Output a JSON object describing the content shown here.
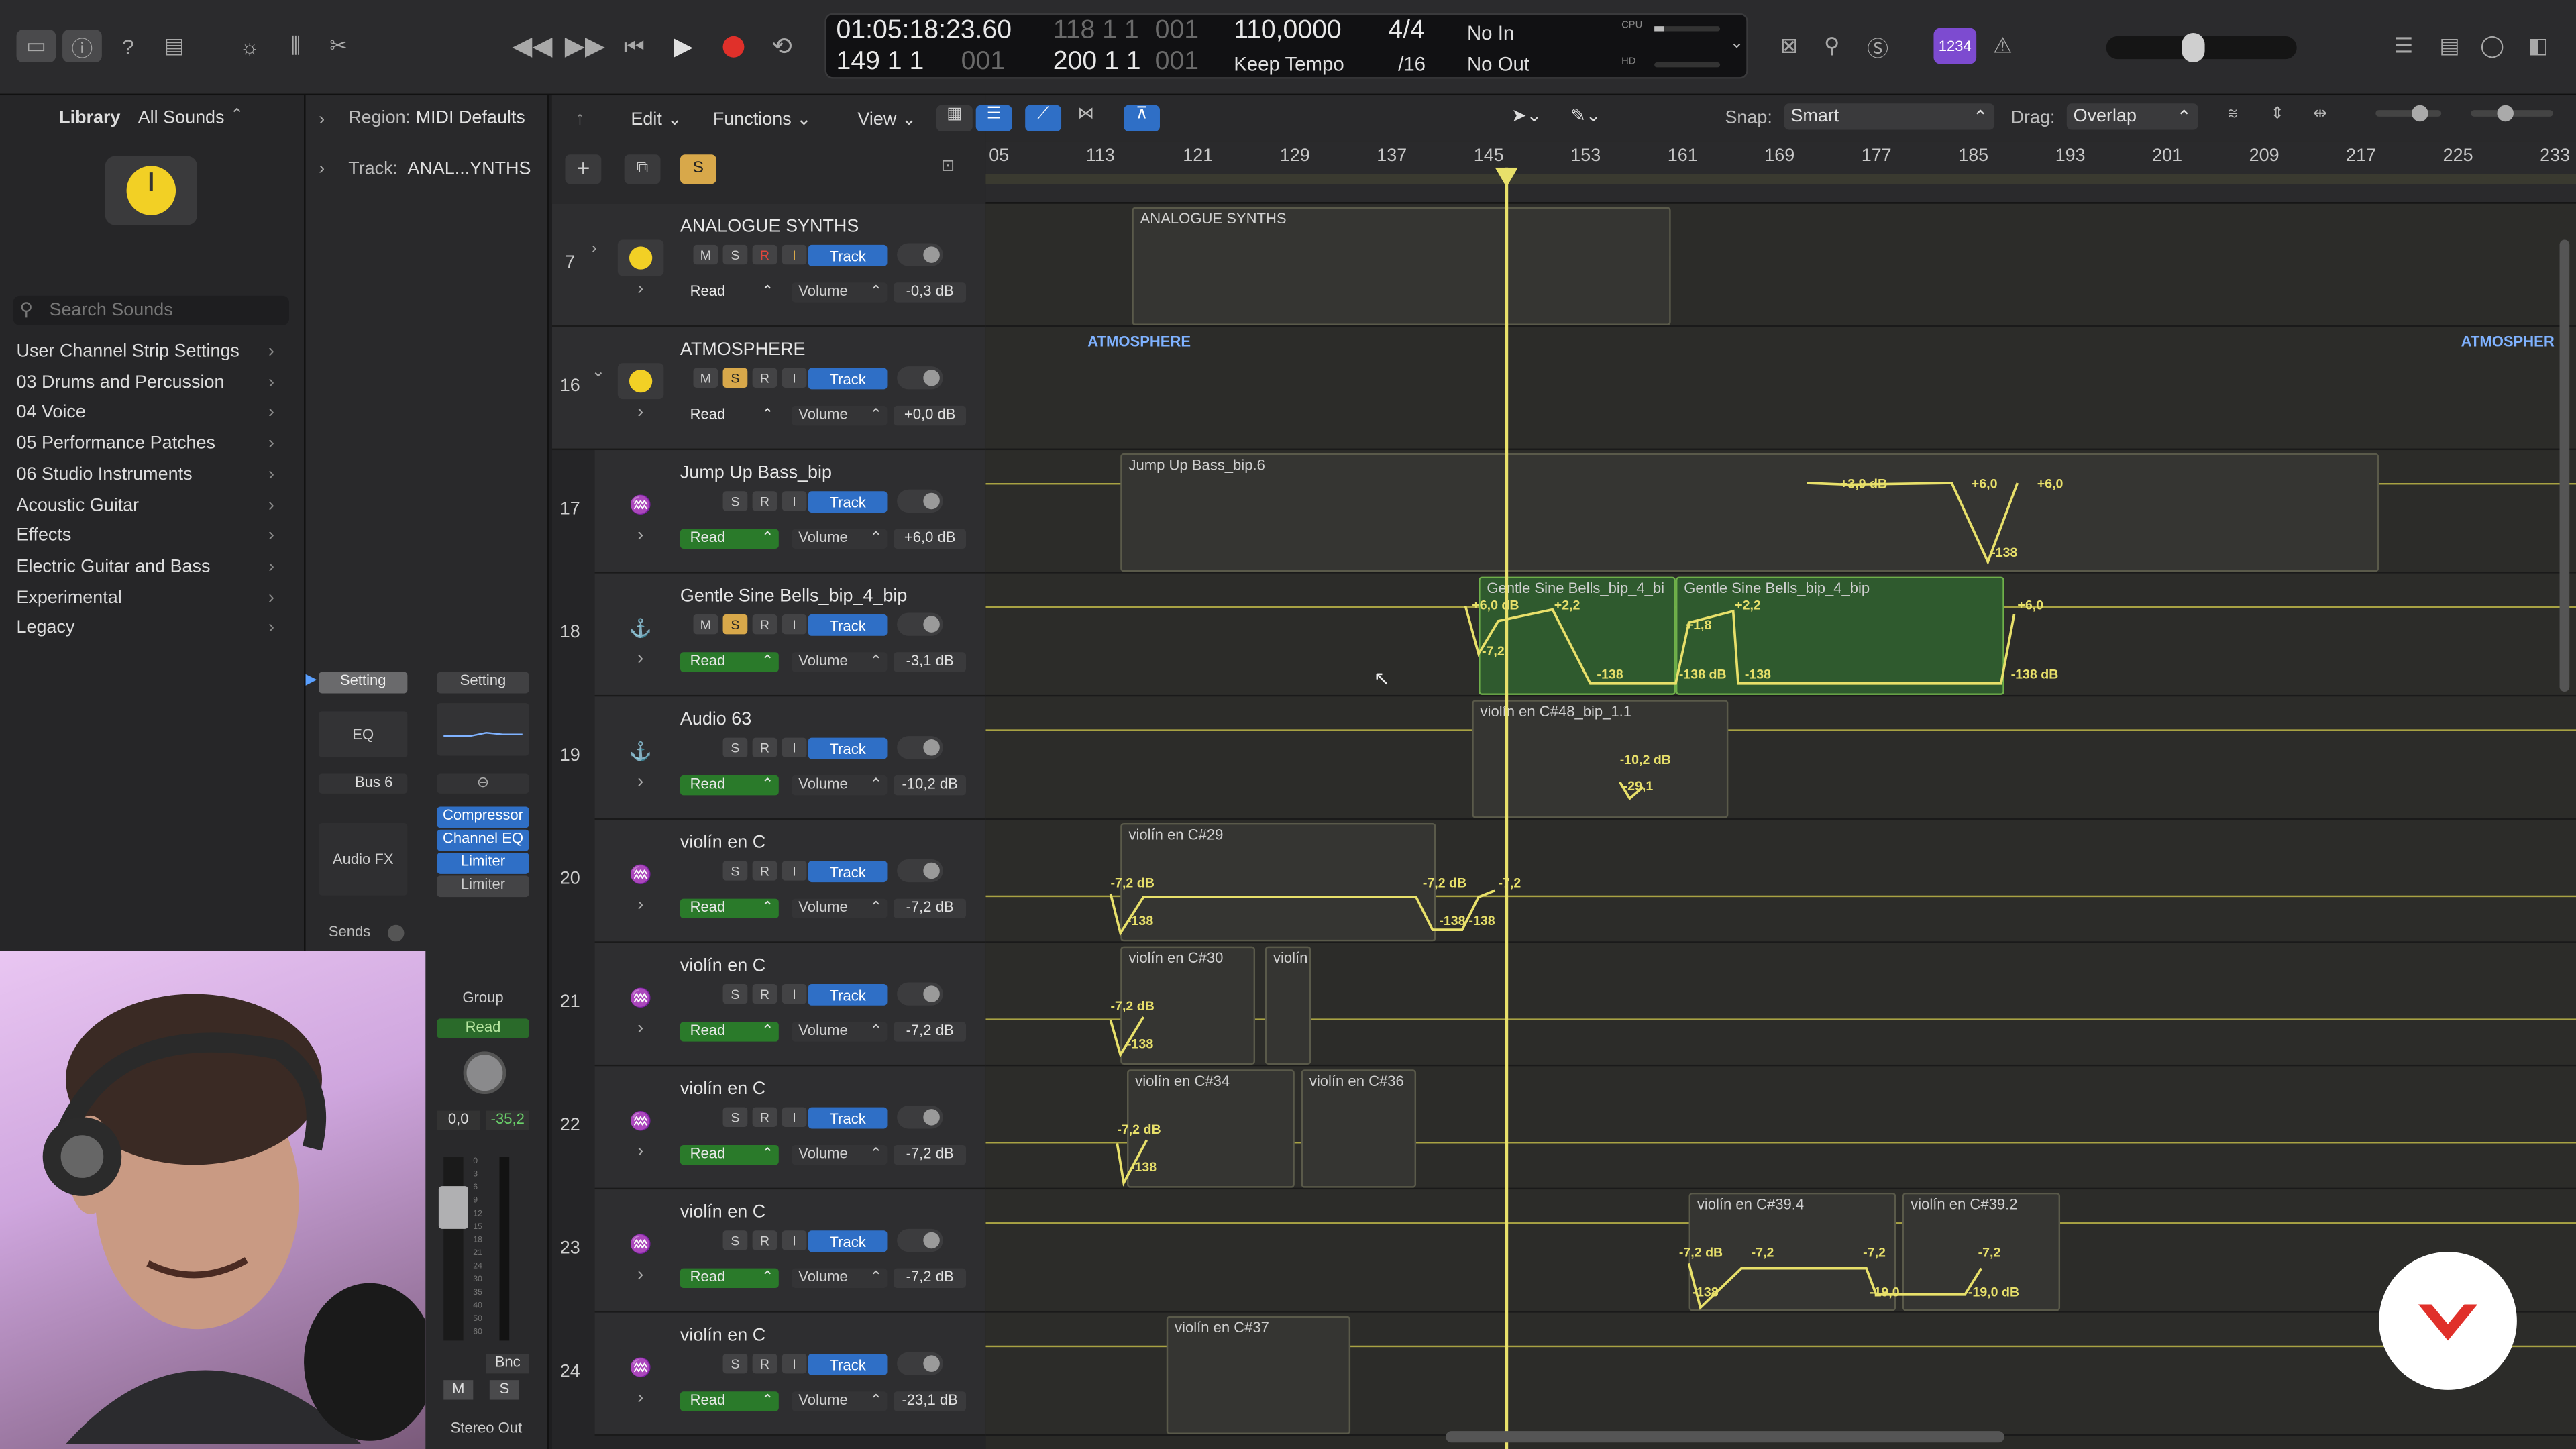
{
  "transport": {
    "position_time": "01:05:18:23.60",
    "position_bars": "149  1  1",
    "position_bars_sub": "001",
    "position_bars_top_dim": "118  1  1",
    "position_bars_top_sub": "001",
    "end_bars": "200  1  1",
    "end_bars_sub": "001",
    "tempo": "110,0000",
    "tempo_mode": "Keep Tempo",
    "signature": "4/4",
    "division": "/16",
    "midi_in": "No In",
    "midi_out": "No Out",
    "cpu_label": "CPU",
    "hd_label": "HD",
    "count_in": "1234"
  },
  "library": {
    "title": "Library",
    "filter": "All Sounds",
    "search_placeholder": "Search Sounds",
    "items": [
      "User Channel Strip Settings",
      "03 Drums and Percussion",
      "04 Voice",
      "05 Performance Patches",
      "06 Studio Instruments",
      "Acoustic Guitar",
      "Effects",
      "Electric Guitar and Bass",
      "Experimental",
      "Legacy"
    ]
  },
  "inspector": {
    "region_label": "Region:",
    "region_value": "MIDI Defaults",
    "track_label": "Track:",
    "track_value": "ANAL...YNTHS",
    "setting": "Setting",
    "setting2": "Setting",
    "eq": "EQ",
    "bus": "Bus 6",
    "audio_fx": "Audio FX",
    "sends": "Sends",
    "plugins": [
      "Compressor",
      "Channel EQ",
      "Limiter",
      "Limiter"
    ],
    "group": "Group",
    "read": "Read",
    "pan_value": "0,0",
    "level_value": "-35,2",
    "bnc": "Bnc",
    "m": "M",
    "s": "S",
    "stereo_out": "Stereo Out",
    "meter_scale": [
      "0",
      "3",
      "6",
      "9",
      "12",
      "15",
      "18",
      "21",
      "24",
      "30",
      "35",
      "40",
      "50",
      "60"
    ]
  },
  "toolbar": {
    "edit": "Edit",
    "functions": "Functions",
    "view": "View",
    "snap_label": "Snap:",
    "snap_value": "Smart",
    "drag_label": "Drag:",
    "drag_value": "Overlap"
  },
  "ruler": [
    "05",
    "113",
    "121",
    "129",
    "137",
    "145",
    "153",
    "161",
    "169",
    "177",
    "185",
    "193",
    "201",
    "209",
    "217",
    "225",
    "233"
  ],
  "tracks": [
    {
      "num": "7",
      "name": "ANALOGUE SYNTHS",
      "mute": false,
      "solo": false,
      "rec": true,
      "input": true,
      "mode": "Read",
      "param": "Volume",
      "db": "-0,3 dB",
      "read_green": false
    },
    {
      "num": "16",
      "name": "ATMOSPHERE",
      "mute": true,
      "solo": true,
      "rec": false,
      "input": false,
      "mode": "Read",
      "param": "Volume",
      "db": "+0,0 dB",
      "read_green": false
    },
    {
      "num": "17",
      "name": "Jump Up Bass_bip",
      "mute": false,
      "solo": false,
      "mode": "Read",
      "param": "Volume",
      "db": "+6,0 dB",
      "read_green": true
    },
    {
      "num": "18",
      "name": "Gentle Sine Bells_bip_4_bip",
      "mute": true,
      "solo": true,
      "mode": "Read",
      "param": "Volume",
      "db": "-3,1 dB",
      "read_green": true
    },
    {
      "num": "19",
      "name": "Audio 63",
      "mute": false,
      "solo": false,
      "mode": "Read",
      "param": "Volume",
      "db": "-10,2 dB",
      "read_green": true
    },
    {
      "num": "20",
      "name": "violín en C",
      "mute": false,
      "solo": false,
      "mode": "Read",
      "param": "Volume",
      "db": "-7,2 dB",
      "read_green": true
    },
    {
      "num": "21",
      "name": "violín en C",
      "mute": false,
      "solo": false,
      "mode": "Read",
      "param": "Volume",
      "db": "-7,2 dB",
      "read_green": true
    },
    {
      "num": "22",
      "name": "violín en C",
      "mute": false,
      "solo": false,
      "mode": "Read",
      "param": "Volume",
      "db": "-7,2 dB",
      "read_green": true
    },
    {
      "num": "23",
      "name": "violín en C",
      "mute": false,
      "solo": false,
      "mode": "Read",
      "param": "Volume",
      "db": "-7,2 dB",
      "read_green": true
    },
    {
      "num": "24",
      "name": "violín en C",
      "mute": false,
      "solo": false,
      "mode": "Read",
      "param": "Volume",
      "db": "-23,1 dB",
      "read_green": true
    }
  ],
  "regions": {
    "analogue": "ANALOGUE SYNTHS",
    "atmosphere": "ATMOSPHERE",
    "atmosphere_right": "ATMOSPHER",
    "jump": "Jump Up Bass_bip.6",
    "bells1": "Gentle Sine Bells_bip_4_bi",
    "bells2": "Gentle Sine Bells_bip_4_bip",
    "violin48": "violín en C#48_bip_1.1",
    "violin29": "violín en C#29",
    "violin30": "violín en C#30",
    "violin_short": "violín",
    "violin34": "violín en C#34",
    "violin36": "violín en C#36",
    "violin39_4": "violín en C#39.4",
    "violin39_2": "violín en C#39.2",
    "violin37": "violín en C#37"
  },
  "automation": {
    "jump": [
      "+3,9 dB",
      "+6,0",
      "+6,0",
      "-138"
    ],
    "bells": [
      "+6,0 dB",
      "-7,2",
      "+2,2",
      "-138",
      "+1,8",
      "-138 dB",
      "-138",
      "+2,2",
      "+6,0",
      "-138 dB"
    ],
    "audio63": [
      "-10,2 dB",
      "-29,1"
    ],
    "v20": [
      "-7,2 dB",
      "-138",
      "-7,2 dB",
      "-138",
      "-138",
      "-7,2"
    ],
    "v21": [
      "-7,2 dB",
      "-138"
    ],
    "v22": [
      "-7,2 dB",
      "-138"
    ],
    "v23": [
      "-7,2 dB",
      "-138",
      "-7,2",
      "-7,2",
      "-19,0",
      "-7,2",
      "-19,0 dB"
    ]
  },
  "colors": {
    "accent": "#2f6fc6",
    "automation": "#e8e06a",
    "solo": "#d8a84a",
    "region_green": "#2f5a2e"
  }
}
